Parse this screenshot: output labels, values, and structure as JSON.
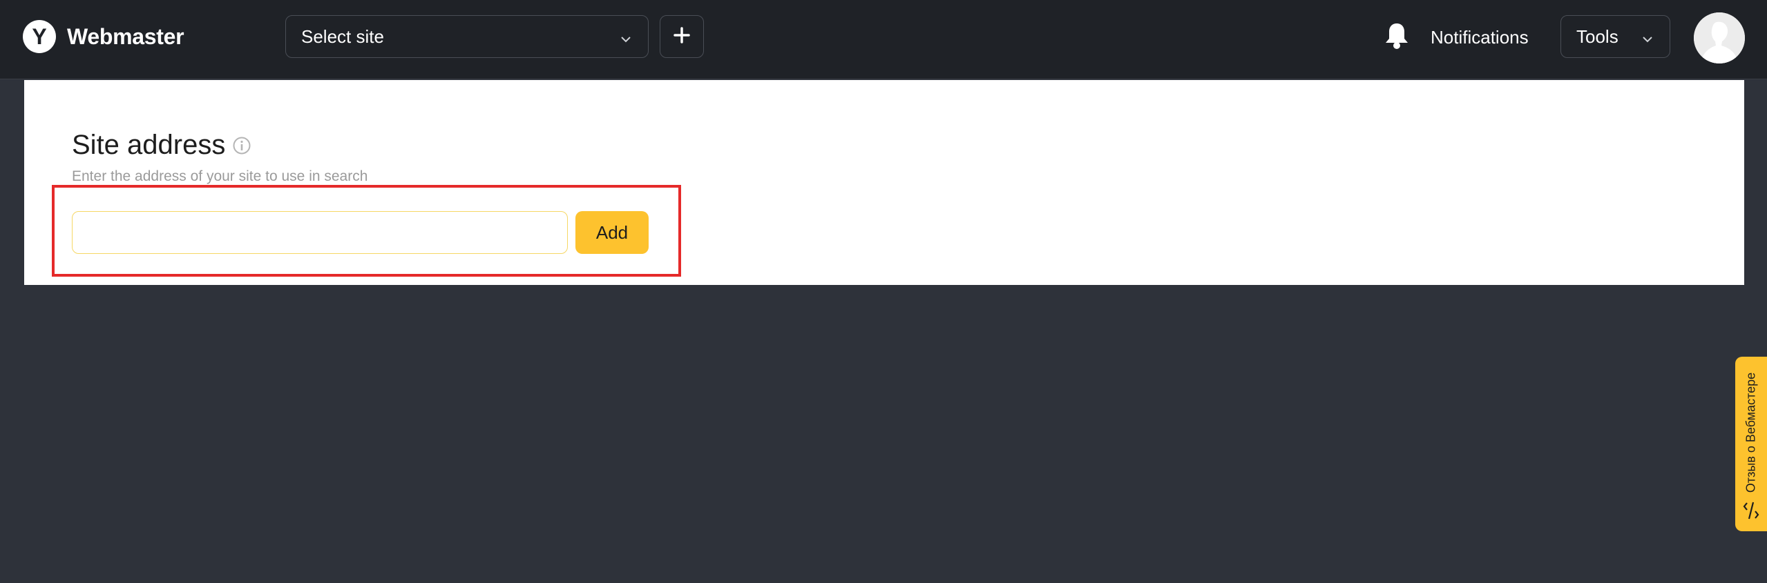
{
  "header": {
    "logo_letter": "Y",
    "app_name": "Webmaster",
    "site_select_label": "Select site",
    "notifications_label": "Notifications",
    "tools_label": "Tools"
  },
  "main": {
    "title": "Site address",
    "subtitle": "Enter the address of your site to use in search",
    "input_value": "",
    "add_button_label": "Add"
  },
  "feedback": {
    "label": "Отзыв о Вебмастере"
  },
  "colors": {
    "header_bg": "#1f2227",
    "page_bg": "#2e323a",
    "accent": "#fdc22e",
    "highlight": "#e52a2a"
  },
  "icons": [
    "yandex-logo-icon",
    "chevron-down-icon",
    "plus-icon",
    "bell-icon",
    "info-icon",
    "avatar-icon",
    "feedback-icon"
  ]
}
